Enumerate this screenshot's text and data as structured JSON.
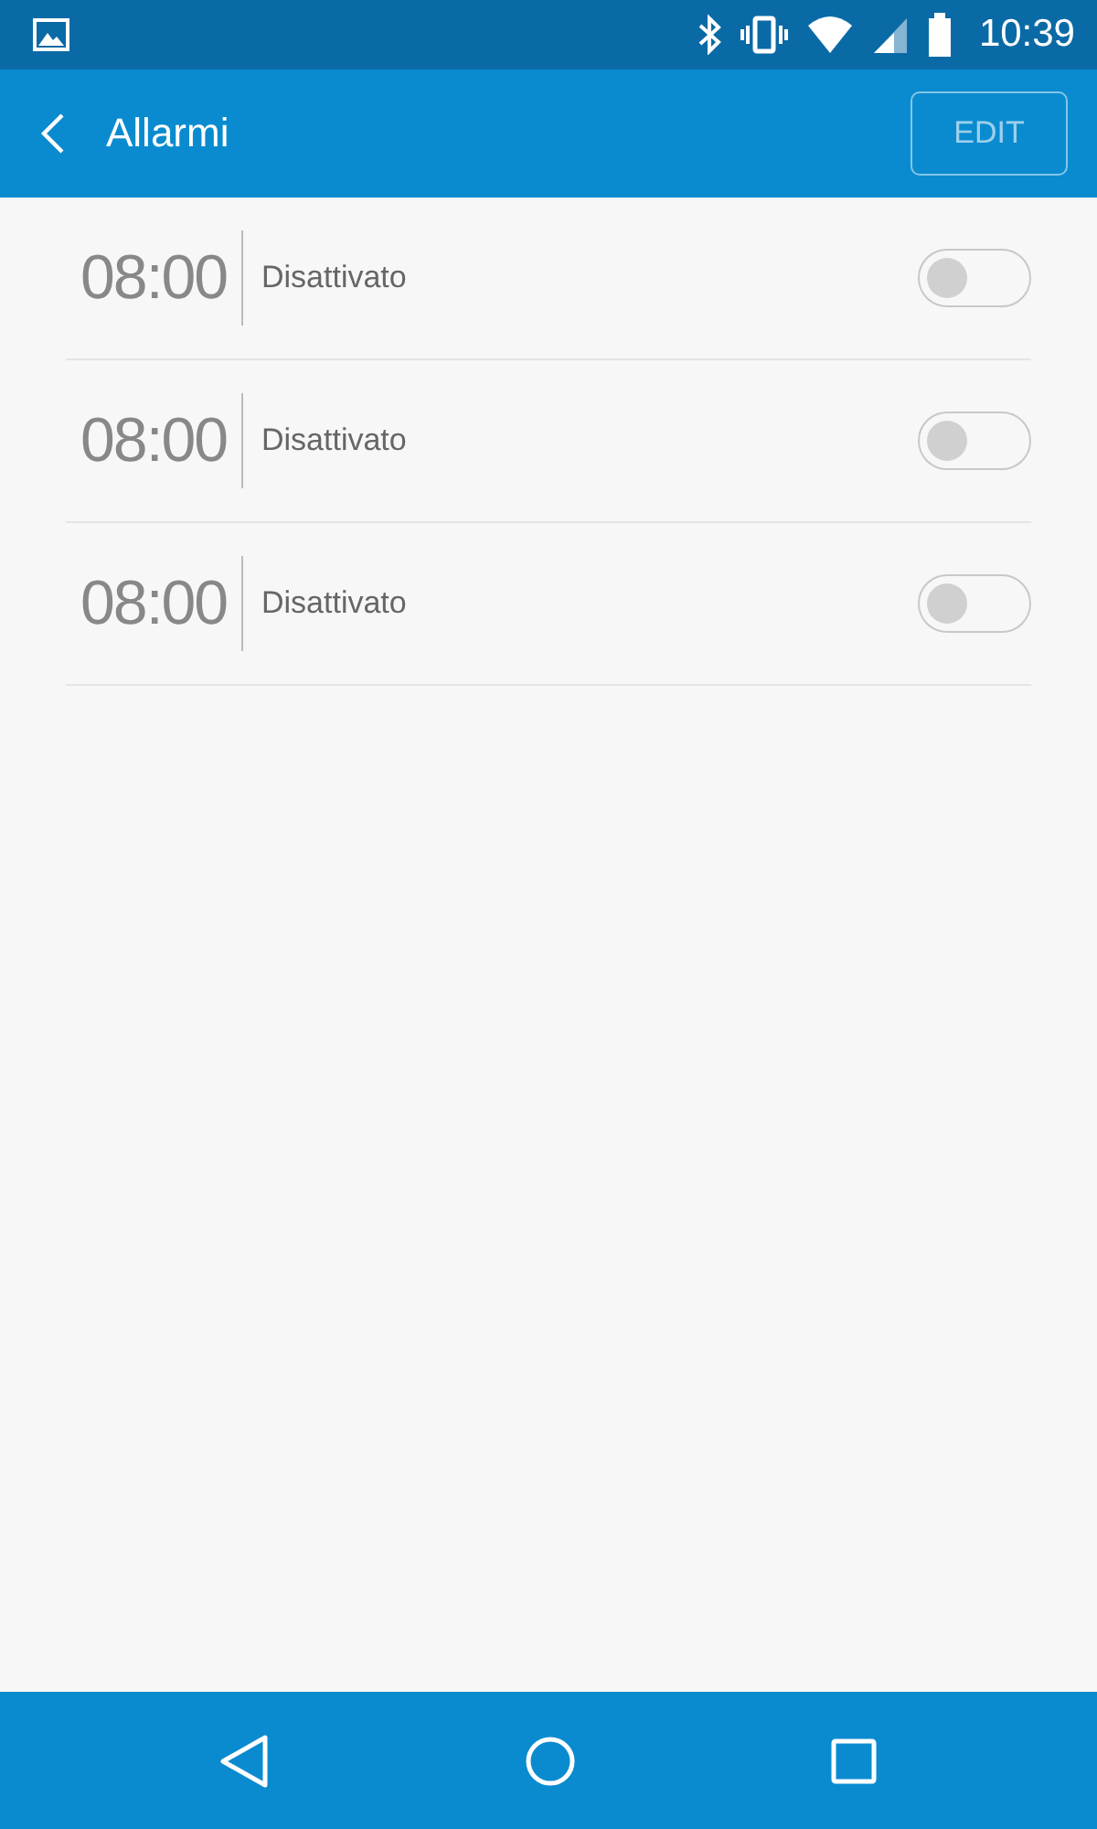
{
  "status_bar": {
    "time": "10:39"
  },
  "header": {
    "title": "Allarmi",
    "edit_button": "EDIT"
  },
  "alarms": [
    {
      "time": "08:00",
      "label": "Disattivato",
      "on": false
    },
    {
      "time": "08:00",
      "label": "Disattivato",
      "on": false
    },
    {
      "time": "08:00",
      "label": "Disattivato",
      "on": false
    }
  ]
}
